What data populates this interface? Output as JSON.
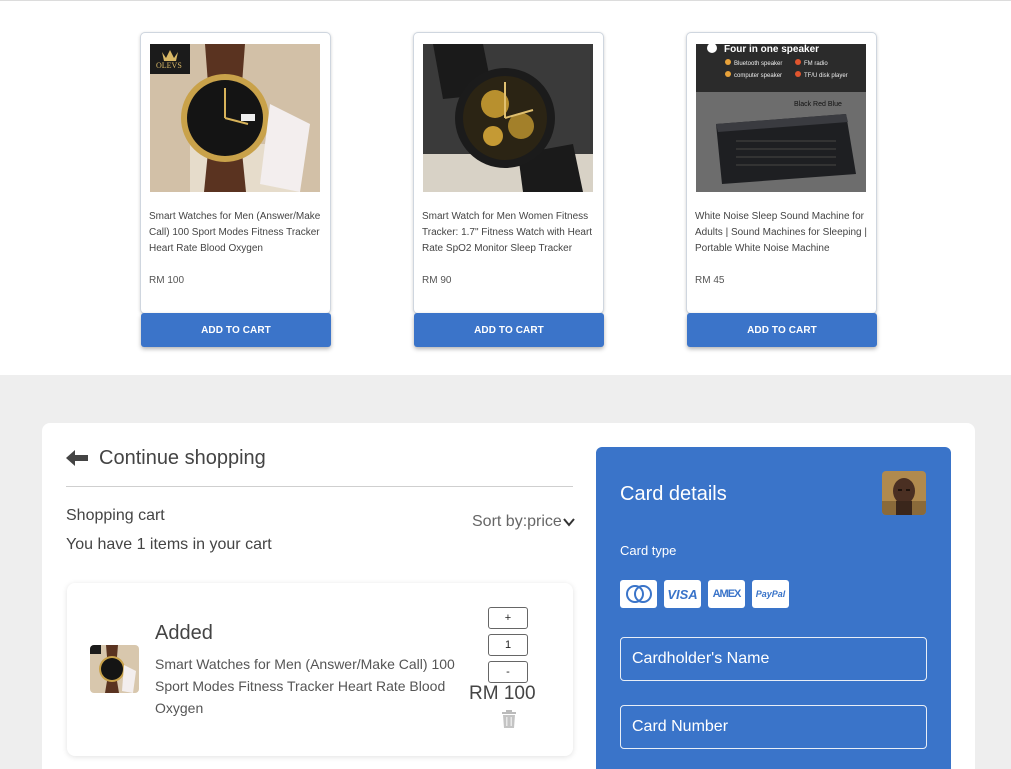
{
  "products": [
    {
      "title": "Smart Watches for Men (Answer/Make Call) 100 Sport Modes Fitness Tracker Heart Rate Blood Oxygen",
      "price": "RM 100",
      "button": "ADD TO CART",
      "image_icon": "watch-image",
      "image_brand": "OLEVS"
    },
    {
      "title": "Smart Watch for Men Women Fitness Tracker: 1.7\" Fitness Watch with Heart Rate SpO2 Monitor Sleep Tracker",
      "price": "RM 90",
      "button": "ADD TO CART",
      "image_icon": "watch-image"
    },
    {
      "title": "White Noise Sleep Sound Machine for Adults | Sound Machines for Sleeping | Portable White Noise Machine",
      "price": "RM 45",
      "button": "ADD TO CART",
      "image_icon": "speaker-image",
      "image_text": {
        "heading": "Four in one speaker",
        "features": [
          "Bluetooth speaker",
          "FM radio",
          "computer speaker",
          "TF/U disk player"
        ],
        "colors": "Black Red Blue"
      }
    }
  ],
  "cart": {
    "back_label": "Continue shopping",
    "title": "Shopping cart",
    "count_text": "You have 1 items in your cart",
    "sort_label": "Sort by:",
    "sort_value": "price",
    "items": [
      {
        "status": "Added",
        "description": "Smart Watches for Men (Answer/Make Call) 100 Sport Modes Fitness Tracker Heart Rate Blood Oxygen",
        "quantity": "1",
        "price": "RM 100",
        "plus": "+",
        "minus": "-"
      }
    ]
  },
  "card_details": {
    "heading": "Card details",
    "card_type_label": "Card type",
    "card_types": [
      "mastercard",
      "VISA",
      "AMEX",
      "PayPal"
    ],
    "name_placeholder": "Cardholder's Name",
    "number_placeholder": "Card Number",
    "accent": "#3a74c9"
  },
  "colors": {
    "button_blue": "#3b74c9",
    "section_gray": "#eeeeee"
  }
}
